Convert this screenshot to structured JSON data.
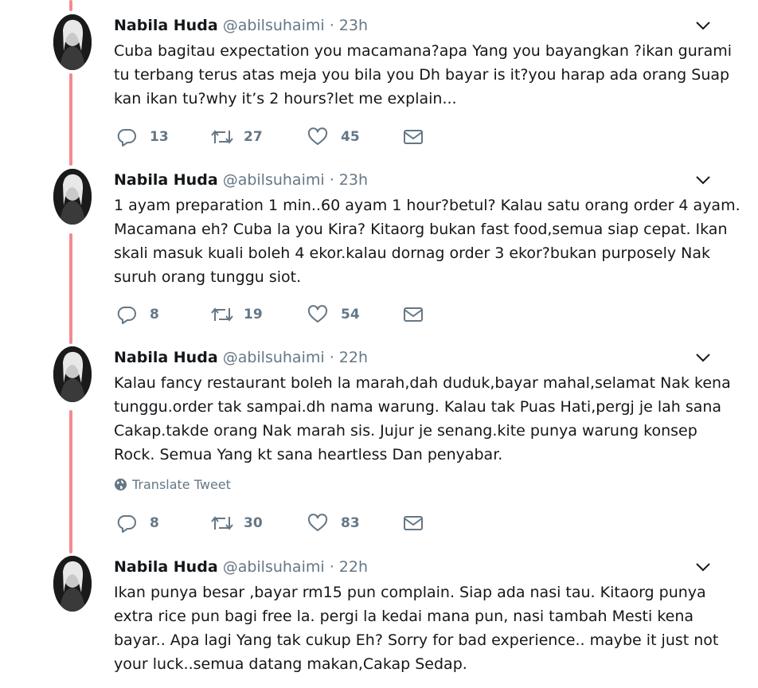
{
  "tweets": [
    {
      "author": "Nabila Huda",
      "handle": "@abilsuhaimi",
      "separator": "·",
      "time": "23h",
      "lines": [
        "Cuba bagitau expectation you macamana?apa Yang you bayangkan ?ikan gurami",
        "tu terbang terus atas meja you bila you Dh bayar is it?you harap ada orang Suap",
        "kan ikan tu?why it’s 2 hours?let me explain..."
      ],
      "replies": "13",
      "retweets": "27",
      "likes": "45"
    },
    {
      "author": "Nabila Huda",
      "handle": "@abilsuhaimi",
      "separator": "·",
      "time": "23h",
      "lines": [
        "1 ayam preparation 1 min..60 ayam 1 hour?betul? Kalau satu orang order 4 ayam.",
        "Macamana eh? Cuba la you Kira? Kitaorg bukan fast food,semua siap cepat. Ikan",
        "skali masuk kuali boleh 4 ekor.kalau dornag order 3 ekor?bukan purposely Nak",
        "suruh orang tunggu siot."
      ],
      "replies": "8",
      "retweets": "19",
      "likes": "54"
    },
    {
      "author": "Nabila Huda",
      "handle": "@abilsuhaimi",
      "separator": "·",
      "time": "22h",
      "lines": [
        "Kalau fancy restaurant boleh la marah,dah duduk,bayar mahal,selamat Nak kena",
        "tunggu.order tak sampai.dh nama warung. Kalau tak Puas Hati,pergj je lah sana",
        "Cakap.takde orang Nak marah sis. Jujur je senang.kite punya warung konsep",
        "Rock. Semua Yang kt sana heartless Dan penyabar."
      ],
      "translate_label": "Translate Tweet",
      "replies": "8",
      "retweets": "30",
      "likes": "83"
    },
    {
      "author": "Nabila Huda",
      "handle": "@abilsuhaimi",
      "separator": "·",
      "time": "22h",
      "lines": [
        "Ikan punya besar ,bayar rm15 pun complain. Siap ada nasi tau. Kitaorg punya",
        "extra rice pun bagi free la. pergi la kedai mana pun, nasi tambah Mesti kena",
        "bayar.. Apa lagi Yang tak cukup Eh? Sorry for bad experience.. maybe it just not",
        "your luck..semua datang makan,Cakap Sedap."
      ]
    }
  ],
  "icons": {
    "reply": "reply-icon",
    "retweet": "retweet-icon",
    "like": "heart-icon",
    "dm": "envelope-icon",
    "caret": "chevron-down-icon",
    "globe": "globe-icon"
  },
  "colors": {
    "thread_line": "#f48a8f",
    "text": "#14171a",
    "muted": "#657786"
  }
}
